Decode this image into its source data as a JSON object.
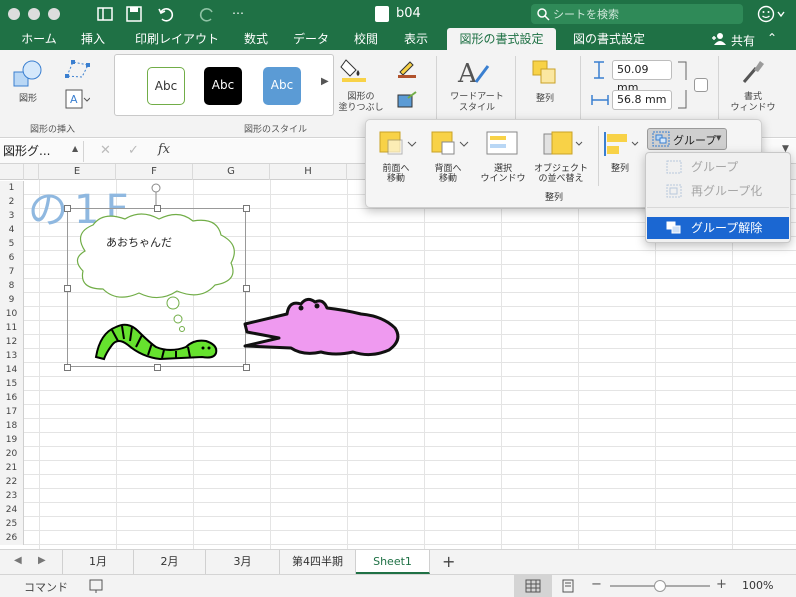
{
  "window": {
    "title": "b04"
  },
  "search": {
    "placeholder": "シートを検索"
  },
  "tabs": [
    {
      "label": "ホーム"
    },
    {
      "label": "挿入"
    },
    {
      "label": "印刷レイアウト"
    },
    {
      "label": "数式"
    },
    {
      "label": "データ"
    },
    {
      "label": "校閲"
    },
    {
      "label": "表示"
    },
    {
      "label": "図形の書式設定"
    },
    {
      "label": "図の書式設定"
    }
  ],
  "share_label": "共有",
  "ribbon": {
    "shape_label": "図形",
    "group_insert_shapes": "図形の挿入",
    "style_samples": [
      "Abc",
      "Abc",
      "Abc"
    ],
    "fill_label": "図形の\n塗りつぶし",
    "group_shape_styles": "図形のスタイル",
    "wordart_label": "ワードアート\nスタイル",
    "arrange_label": "整列",
    "height_value": "50.09 mm",
    "width_value": "56.8 mm",
    "format_pane_label": "書式\nウィンドウ",
    "group_format": "書式"
  },
  "formula_bar": {
    "name_box": "図形グ...",
    "fx": "fx"
  },
  "columns": [
    "E",
    "F",
    "G",
    "H"
  ],
  "rows": [
    "1",
    "2",
    "3",
    "4",
    "5",
    "6",
    "7",
    "8",
    "9",
    "10",
    "11",
    "12",
    "13",
    "14",
    "15",
    "16",
    "17",
    "18",
    "19",
    "20",
    "21",
    "22",
    "23",
    "24",
    "25",
    "26"
  ],
  "sheet": {
    "partial_text": "の1F",
    "bubble_text": "あおちゃんだ"
  },
  "arrange_popup": {
    "bring_forward": "前面へ\n移動",
    "send_backward": "背面へ\n移動",
    "selection_pane": "選択\nウインドウ",
    "reorder_objects": "オブジェクト\nの並べ替え",
    "align": "整列",
    "group_button": "グループ",
    "caption": "整列"
  },
  "group_menu": {
    "items": [
      {
        "label": "グループ",
        "enabled": false
      },
      {
        "label": "再グループ化",
        "enabled": false
      },
      {
        "label": "グループ解除",
        "enabled": true,
        "highlighted": true
      }
    ]
  },
  "sheet_tabs": [
    {
      "label": "1月"
    },
    {
      "label": "2月"
    },
    {
      "label": "3月"
    },
    {
      "label": "第4四半期"
    },
    {
      "label": "Sheet1",
      "active": true
    }
  ],
  "status": {
    "mode": "コマンド",
    "zoom": "100%",
    "zoom_fraction": 0.5
  },
  "colors": {
    "excel_green": "#1f7145",
    "menu_highlight": "#1b67d2",
    "worm_green": "#66e22e",
    "croc_pink": "#ef9af0",
    "shape_yellow": "#f8d247"
  }
}
